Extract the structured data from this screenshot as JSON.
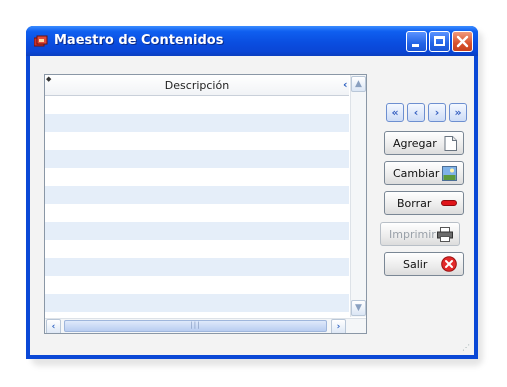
{
  "window": {
    "title": "Maestro de Contenidos",
    "controls": {
      "minimize": "minimize",
      "maximize": "maximize",
      "close": "close"
    }
  },
  "grid": {
    "columns": [
      "Descripción"
    ],
    "rows": []
  },
  "nav_buttons": [
    {
      "name": "first-record-button",
      "glyph": "«"
    },
    {
      "name": "previous-record-button",
      "glyph": "‹"
    },
    {
      "name": "next-record-button",
      "glyph": "›"
    },
    {
      "name": "last-record-button",
      "glyph": "»"
    }
  ],
  "actions": {
    "add": {
      "label": "Agregar",
      "icon": "new-document-icon"
    },
    "change": {
      "label": "Cambiar",
      "icon": "picture-icon"
    },
    "delete": {
      "label": "Borrar",
      "icon": "red-dash-icon"
    },
    "print": {
      "label": "Imprimir",
      "icon": "printer-icon",
      "enabled": false
    },
    "exit": {
      "label": "Salir",
      "icon": "red-x-icon"
    }
  },
  "colors": {
    "titlebar": "#0a4ee0",
    "row_alt": "#e5eef9",
    "close_button": "#d8512b"
  }
}
